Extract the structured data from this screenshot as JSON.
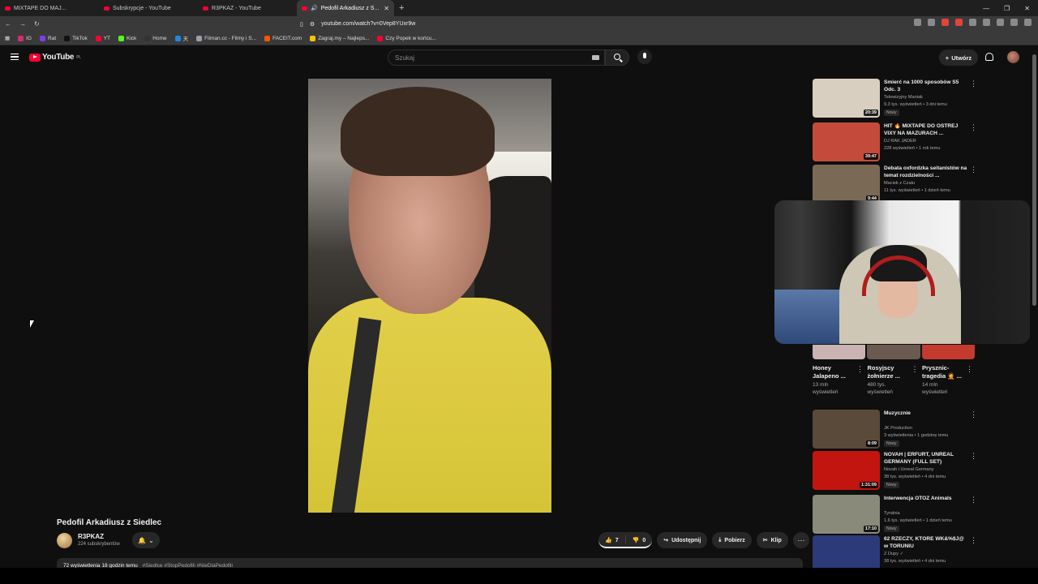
{
  "browser": {
    "tabs": [
      {
        "label": "MIXTAPE DO MAJ..."
      },
      {
        "label": "Subskrypcje - YouTube"
      },
      {
        "label": "R3PKAZ - YouTube"
      },
      {
        "label": "Pedofil Arkadiusz z S..."
      }
    ],
    "url": "youtube.com/watch?v=0Vep8YUxr9w",
    "bookmarks": [
      {
        "label": "IG",
        "color": "#d62976"
      },
      {
        "label": "Rat",
        "color": "#7b3fe4"
      },
      {
        "label": "TikTok",
        "color": "#111111"
      },
      {
        "label": "YT",
        "color": "#ff0033"
      },
      {
        "label": "Kick",
        "color": "#53fc18"
      },
      {
        "label": "Home",
        "color": "#333333"
      },
      {
        "label": "天",
        "color": "#1e88e5"
      },
      {
        "label": "Filman.cc - Filmy i S...",
        "color": "#9aa0a6"
      },
      {
        "label": "FACEIT.com",
        "color": "#ff5500"
      },
      {
        "label": "Zagraj.my – Najleps...",
        "color": "#f5c400"
      },
      {
        "label": "Czy Popek w końcu...",
        "color": "#ff0033"
      }
    ]
  },
  "header": {
    "logo_text": "YouTube",
    "region": "PL",
    "search_placeholder": "Szukaj",
    "create_label": "Utwórz"
  },
  "video": {
    "title": "Pedofil Arkadiusz z Siedlec",
    "channel": "R3PKAZ",
    "subscribers": "224 subskrybentów",
    "likes": "7",
    "dislikes": "0",
    "share_label": "Udostępnij",
    "download_label": "Pobierz",
    "clip_label": "Klip",
    "desc_stats": "72 wyświetlenia  18 godzin temu",
    "desc_tags": "#Siedlce #StopPedofili #NieDlaPedofili"
  },
  "recommendations_top": [
    {
      "title": "Śmierć na 1000 sposobów S5 Odc. 3",
      "channel": "Telewizyjny Maniak",
      "meta": "9,3 tys. wyświetleń • 3 dni temu",
      "badge": "Nowy",
      "duration": "20:39",
      "thumb_color": "#d8cfc0"
    },
    {
      "title": "HIT 🔥 MIXTAPE DO OSTREJ VIXY NA MAZURACH ...",
      "channel": "DJ RAK JADER",
      "meta": "228 wyświetleń • 1 rok temu",
      "badge": "",
      "duration": "39:47",
      "thumb_color": "#c44b3b"
    },
    {
      "title": "Debata oxfordzka seitanistów na temat rozdzielności ...",
      "channel": "Maciek z Czatu",
      "meta": "11 tys. wyświetleń • 1 dzień temu",
      "badge": "",
      "duration": "9:44",
      "thumb_color": "#7a6a55"
    }
  ],
  "shorts": [
    {
      "title": "Honey Jalapeno ...",
      "views": "13 mln wyświetleń",
      "color": "#c9b3b3"
    },
    {
      "title": "Rosyjscy żołnierze ...",
      "views": "480 tys. wyświetleń",
      "color": "#6b5a50"
    },
    {
      "title": "Prysznic-tragedia 🤦 ...",
      "views": "14 mln wyświetleń",
      "color": "#c43a2f"
    }
  ],
  "recommendations_bottom": [
    {
      "title": "Muzycznie",
      "channel": "JK Production",
      "meta": "3 wyświetlenia • 1 godzinę temu",
      "badge": "Nowy",
      "duration": "8:09",
      "thumb_color": "#5a4a3a"
    },
    {
      "title": "NOVAH | ERFURT, UNREAL GERMANY (FULL SET)",
      "channel": "Novah i Unreal Germany",
      "meta": "38 tys. wyświetleń • 4 dni temu",
      "badge": "Nowy",
      "duration": "1:31:09",
      "thumb_color": "#c2150f"
    },
    {
      "title": "Interwencja OTOZ Animals",
      "channel": "Tyralnia",
      "meta": "1,6 tys. wyświetleń • 1 dzień temu",
      "badge": "Nowy",
      "duration": "17:10",
      "thumb_color": "#8a8a7a"
    },
    {
      "title": "62 RZECZY, KTÓRE WK&%$J@ w TORUNIU",
      "channel": "Z Dupy ✓",
      "meta": "38 tys. wyświetleń • 4 dni temu",
      "badge": "",
      "duration": "",
      "thumb_color": "#2c3a7a"
    }
  ]
}
